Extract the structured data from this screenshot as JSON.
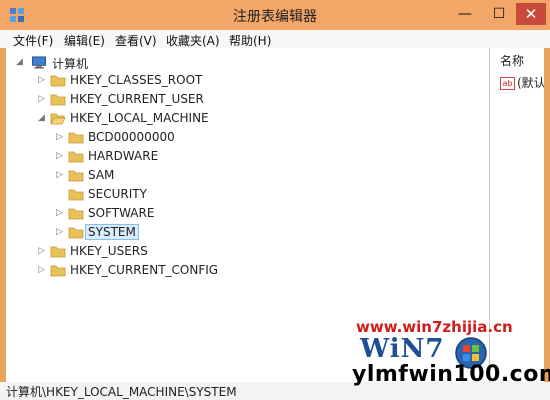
{
  "window": {
    "title": "注册表编辑器",
    "minimize_glyph": "—",
    "maximize_glyph": "☐",
    "close_glyph": "✕"
  },
  "menu": {
    "items": [
      "文件(F)",
      "编辑(E)",
      "查看(V)",
      "收藏夹(A)",
      "帮助(H)"
    ]
  },
  "tree": {
    "root": "计算机",
    "nodes": [
      {
        "label": "HKEY_CLASSES_ROOT",
        "expanded": false
      },
      {
        "label": "HKEY_CURRENT_USER",
        "expanded": false
      },
      {
        "label": "HKEY_LOCAL_MACHINE",
        "expanded": true
      },
      {
        "label": "BCD00000000",
        "expanded": false
      },
      {
        "label": "HARDWARE",
        "expanded": false
      },
      {
        "label": "SAM",
        "expanded": false
      },
      {
        "label": "SECURITY",
        "expanded": false
      },
      {
        "label": "SOFTWARE",
        "expanded": false
      },
      {
        "label": "SYSTEM",
        "expanded": false,
        "selected": true
      },
      {
        "label": "HKEY_USERS",
        "expanded": false
      },
      {
        "label": "HKEY_CURRENT_CONFIG",
        "expanded": false
      }
    ]
  },
  "values_pane": {
    "column_header": "名称",
    "value_icon_text": "ab",
    "row_name": "(默认"
  },
  "status": {
    "path": "计算机\\HKEY_LOCAL_MACHINE\\SYSTEM"
  },
  "watermarks": {
    "site1": "www.win7zhijia.cn",
    "logo_text": "WiN7",
    "site2": "ylmfwin100.com"
  },
  "colors": {
    "title_bar": "#f2a768",
    "close_button": "#c74a3a",
    "selection": "#d9ecfb",
    "folder": "#e8c15a",
    "watermark_red": "#d31b1b",
    "watermark_blue": "#1e4f94"
  }
}
